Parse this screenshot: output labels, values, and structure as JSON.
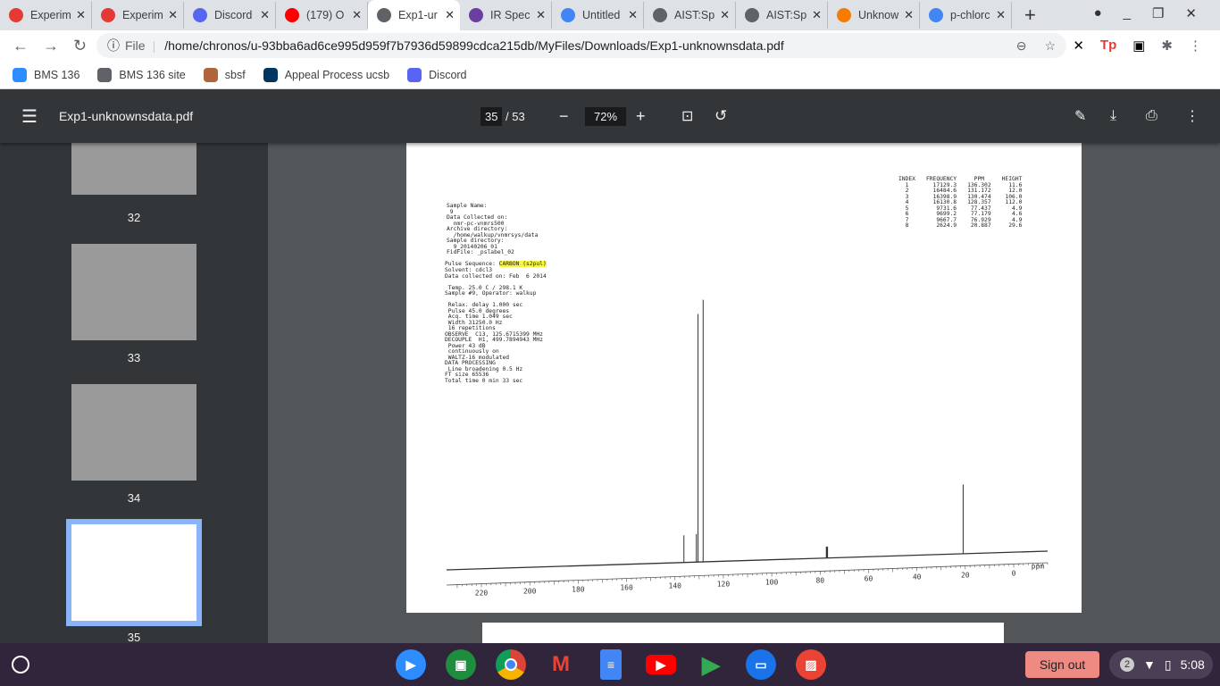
{
  "browser": {
    "tabs": [
      {
        "title": "Experim",
        "icon": "experiment-icon",
        "color": "#e53935"
      },
      {
        "title": "Experim",
        "icon": "experiment-icon",
        "color": "#e53935"
      },
      {
        "title": "Discord",
        "icon": "discord-icon",
        "color": "#5865f2"
      },
      {
        "title": "(179) O",
        "icon": "youtube-icon",
        "color": "#ff0000"
      },
      {
        "title": "Exp1-ur",
        "icon": "globe-icon",
        "color": "#5f6368",
        "active": true
      },
      {
        "title": "IR Spec",
        "icon": "m-icon",
        "color": "#6b3fa0"
      },
      {
        "title": "Untitled",
        "icon": "docs-icon",
        "color": "#4285f4"
      },
      {
        "title": "AIST:Sp",
        "icon": "globe-icon",
        "color": "#5f6368"
      },
      {
        "title": "AIST:Sp",
        "icon": "globe-icon",
        "color": "#5f6368"
      },
      {
        "title": "Unknow",
        "icon": "c-icon",
        "color": "#f57c00"
      },
      {
        "title": "p-chlorc",
        "icon": "google-icon",
        "color": "#4285f4"
      }
    ],
    "address": {
      "scheme": "File",
      "url": "/home/chronos/u-93bba6ad6ce995d959f7b7936d59899cdca215db/MyFiles/Downloads/Exp1-unknownsdata.pdf"
    },
    "bookmarks": [
      {
        "label": "BMS 136",
        "color": "#2d8cff"
      },
      {
        "label": "BMS 136 site",
        "color": "#5f6368"
      },
      {
        "label": "sbsf",
        "color": "#b0643a"
      },
      {
        "label": "Appeal Process ucsb",
        "color": "#003660"
      },
      {
        "label": "Discord",
        "color": "#5865f2"
      }
    ]
  },
  "viewer": {
    "title": "Exp1-unknownsdata.pdf",
    "page": "35",
    "total": "/ 53",
    "zoom": "72%",
    "thumbs": [
      "32",
      "33",
      "34",
      "35"
    ]
  },
  "doc": {
    "params": "Sample Name:\n 9\nData Collected on:\n  nmr-pc-vnmrs500\nArchive directory:\n  /home/walkup/vnmrsys/data\nSample directory:\n  9_20140206_01\nFidFile: _pslabel_02",
    "pulse_label": "Pulse Sequence: ",
    "pulse_value": "CARBON (s2pul)",
    "params2": "Solvent: cdcl3\nData collected on: Feb  6 2014\n\n Temp. 25.0 C / 298.1 K\nSample #9, Operator: walkup\n\n Relax. delay 1.000 sec\n Pulse 45.0 degrees\n Acq. time 1.049 sec\n Width 31250.0 Hz\n 16 repetitions\nOBSERVE  C13, 125.6715399 MHz\nDECOUPLE  H1, 499.7894943 MHz\n Power 43 dB\n continuously on\n WALTZ-16 modulated\nDATA PROCESSING\n Line broadening 0.5 Hz\nFT size 65536\nTotal time 0 min 33 sec",
    "peak_headers": [
      "INDEX",
      "FREQUENCY",
      "PPM",
      "HEIGHT"
    ],
    "peaks": [
      [
        "1",
        "17129.3",
        "136.302",
        "11.6"
      ],
      [
        "2",
        "16484.6",
        "131.172",
        "12.0"
      ],
      [
        "3",
        "16398.9",
        "130.474",
        "106.0"
      ],
      [
        "4",
        "16130.8",
        "128.357",
        "112.0"
      ],
      [
        "5",
        "9731.6",
        "77.437",
        "4.9"
      ],
      [
        "6",
        "9699.2",
        "77.179",
        "4.6"
      ],
      [
        "7",
        "9667.7",
        "76.929",
        "4.9"
      ],
      [
        "8",
        "2624.9",
        "20.887",
        "29.6"
      ]
    ],
    "axis_ticks": [
      "220",
      "200",
      "180",
      "160",
      "140",
      "120",
      "100",
      "80",
      "60",
      "40",
      "20",
      "0"
    ],
    "axis_unit": "ppm"
  },
  "shelf": {
    "signout": "Sign out",
    "notifications": "2",
    "time": "5:08"
  }
}
